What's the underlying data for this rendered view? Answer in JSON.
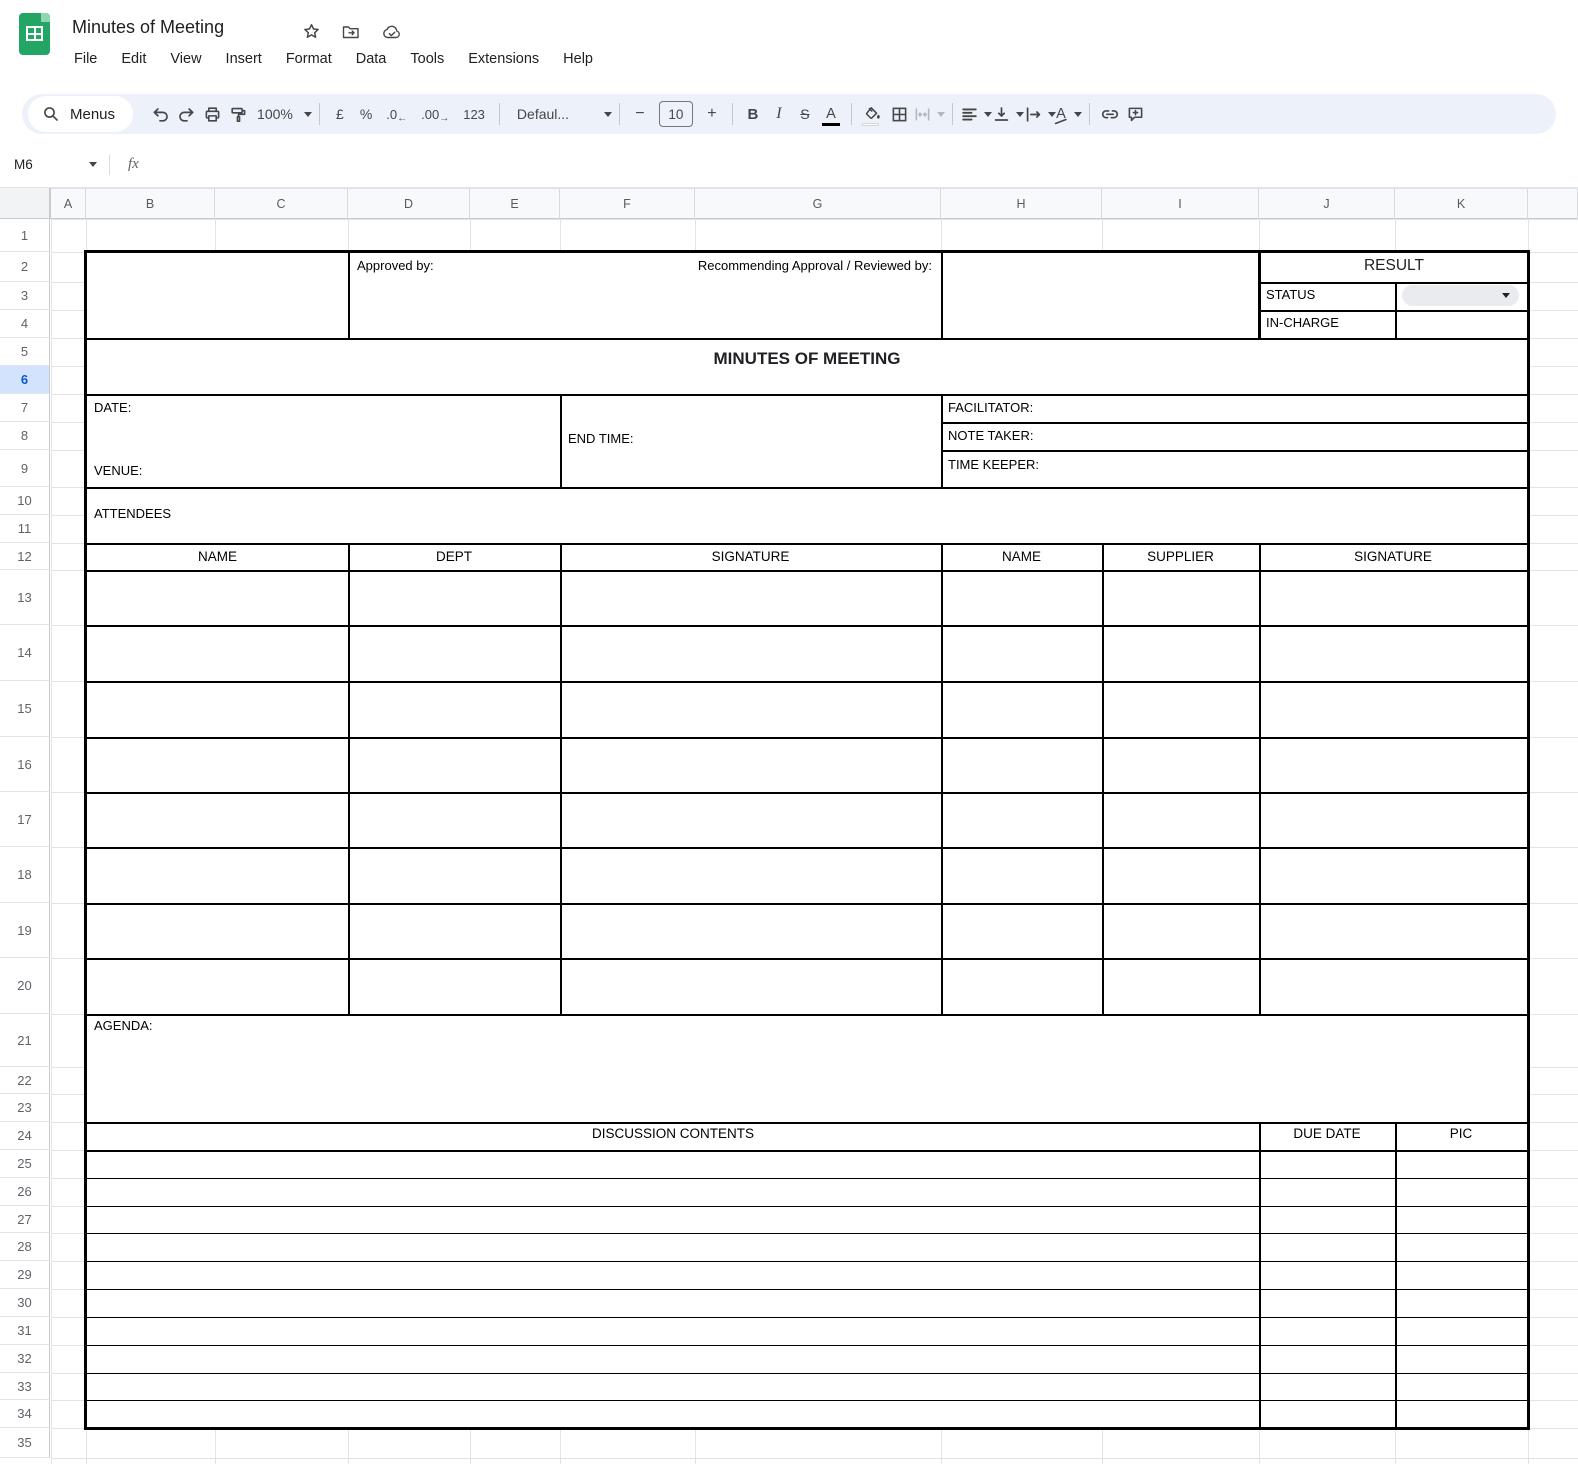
{
  "titlebar": {
    "title": "Minutes of Meeting",
    "menus": [
      "File",
      "Edit",
      "View",
      "Insert",
      "Format",
      "Data",
      "Tools",
      "Extensions",
      "Help"
    ]
  },
  "toolbar": {
    "menus_label": "Menus",
    "zoom": "100%",
    "currency": "£",
    "percent": "%",
    "decrease_decimal": ".0",
    "increase_decimal": ".00",
    "more_formats": "123",
    "font_name": "Defaul...",
    "font_size": "10",
    "minus": "−",
    "plus": "+",
    "bold": "B",
    "italic": "I",
    "strikethrough": "S",
    "text_color": "A",
    "text_rotation": "A"
  },
  "formula_bar": {
    "cell_ref": "M6",
    "fx_label": "fx"
  },
  "grid": {
    "columns": [
      "A",
      "B",
      "C",
      "D",
      "E",
      "F",
      "G",
      "H",
      "I",
      "J",
      "K",
      ""
    ],
    "rows": [
      "1",
      "2",
      "3",
      "4",
      "5",
      "6",
      "7",
      "8",
      "9",
      "10",
      "11",
      "12",
      "13",
      "14",
      "15",
      "16",
      "17",
      "18",
      "19",
      "20",
      "21",
      "22",
      "23",
      "24",
      "25",
      "26",
      "27",
      "28",
      "29",
      "30",
      "31",
      "32",
      "33",
      "34",
      "35"
    ],
    "selected_row": "6"
  },
  "form": {
    "approved_by": "Approved by:",
    "recommending": "Recommending Approval / Reviewed by:",
    "result": "RESULT",
    "status": "STATUS",
    "in_charge": "IN-CHARGE",
    "title": "MINUTES OF MEETING",
    "date": "DATE:",
    "venue": "VENUE:",
    "end_time": "END TIME:",
    "facilitator": "FACILITATOR:",
    "note_taker": "NOTE TAKER:",
    "time_keeper": "TIME KEEPER:",
    "attendees": "ATTENDEES",
    "attendee_headers": [
      "NAME",
      "DEPT",
      "SIGNATURE",
      "NAME",
      "SUPPLIER",
      "SIGNATURE"
    ],
    "agenda": "AGENDA:",
    "discussion_headers": [
      "DISCUSSION CONTENTS",
      "DUE DATE",
      "PIC"
    ]
  },
  "colors": {
    "logo_green": "#23a566",
    "selected_row_bg": "#d3e3fd",
    "selected_row_text": "#0b57d0",
    "toolbar_bg": "#edf2fa",
    "icon_gray": "#444746",
    "chip_bg": "#e9ebee"
  }
}
